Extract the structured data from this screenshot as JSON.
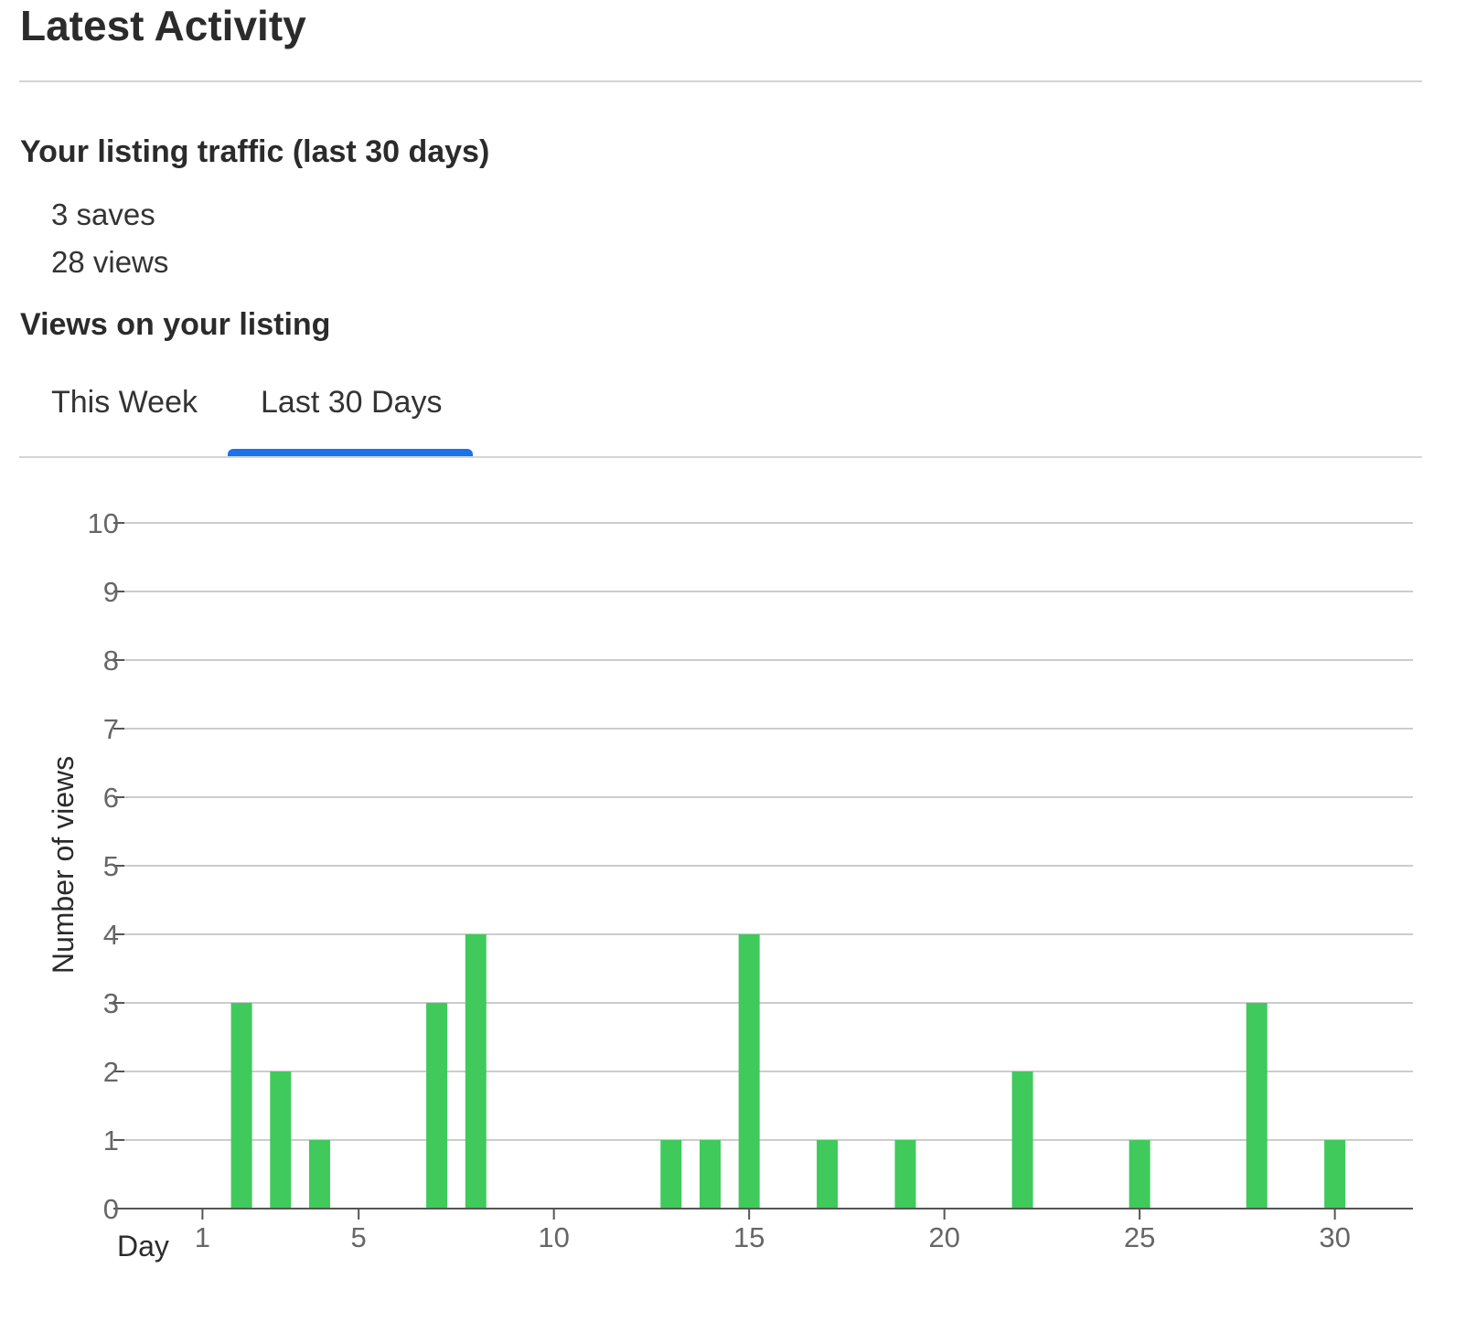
{
  "header": {
    "title": "Latest Activity"
  },
  "traffic": {
    "heading": "Your listing traffic (last 30 days)",
    "saves": "3 saves",
    "views": "28 views"
  },
  "views_section": {
    "heading": "Views on your listing",
    "tabs": [
      {
        "label": "This Week",
        "active": false
      },
      {
        "label": "Last 30 Days",
        "active": true
      }
    ]
  },
  "colors": {
    "bar": "#3fca5b",
    "tab_indicator": "#1a73e8",
    "grid": "#cccccc",
    "axis": "#555555"
  },
  "chart_data": {
    "type": "bar",
    "xlabel": "Day",
    "ylabel": "Number of views",
    "xlim": [
      -1,
      32
    ],
    "ylim": [
      0,
      10
    ],
    "x_ticks": [
      1,
      5,
      10,
      15,
      20,
      25,
      30
    ],
    "y_ticks": [
      0,
      1,
      2,
      3,
      4,
      5,
      6,
      7,
      8,
      9,
      10
    ],
    "grid": true,
    "x": [
      1,
      2,
      3,
      4,
      5,
      6,
      7,
      8,
      9,
      10,
      11,
      12,
      13,
      14,
      15,
      16,
      17,
      18,
      19,
      20,
      21,
      22,
      23,
      24,
      25,
      26,
      27,
      28,
      29,
      30
    ],
    "values": [
      0,
      3,
      2,
      1,
      0,
      0,
      3,
      4,
      0,
      0,
      0,
      0,
      1,
      1,
      4,
      0,
      1,
      0,
      1,
      0,
      0,
      2,
      0,
      0,
      1,
      0,
      0,
      3,
      0,
      1
    ]
  }
}
